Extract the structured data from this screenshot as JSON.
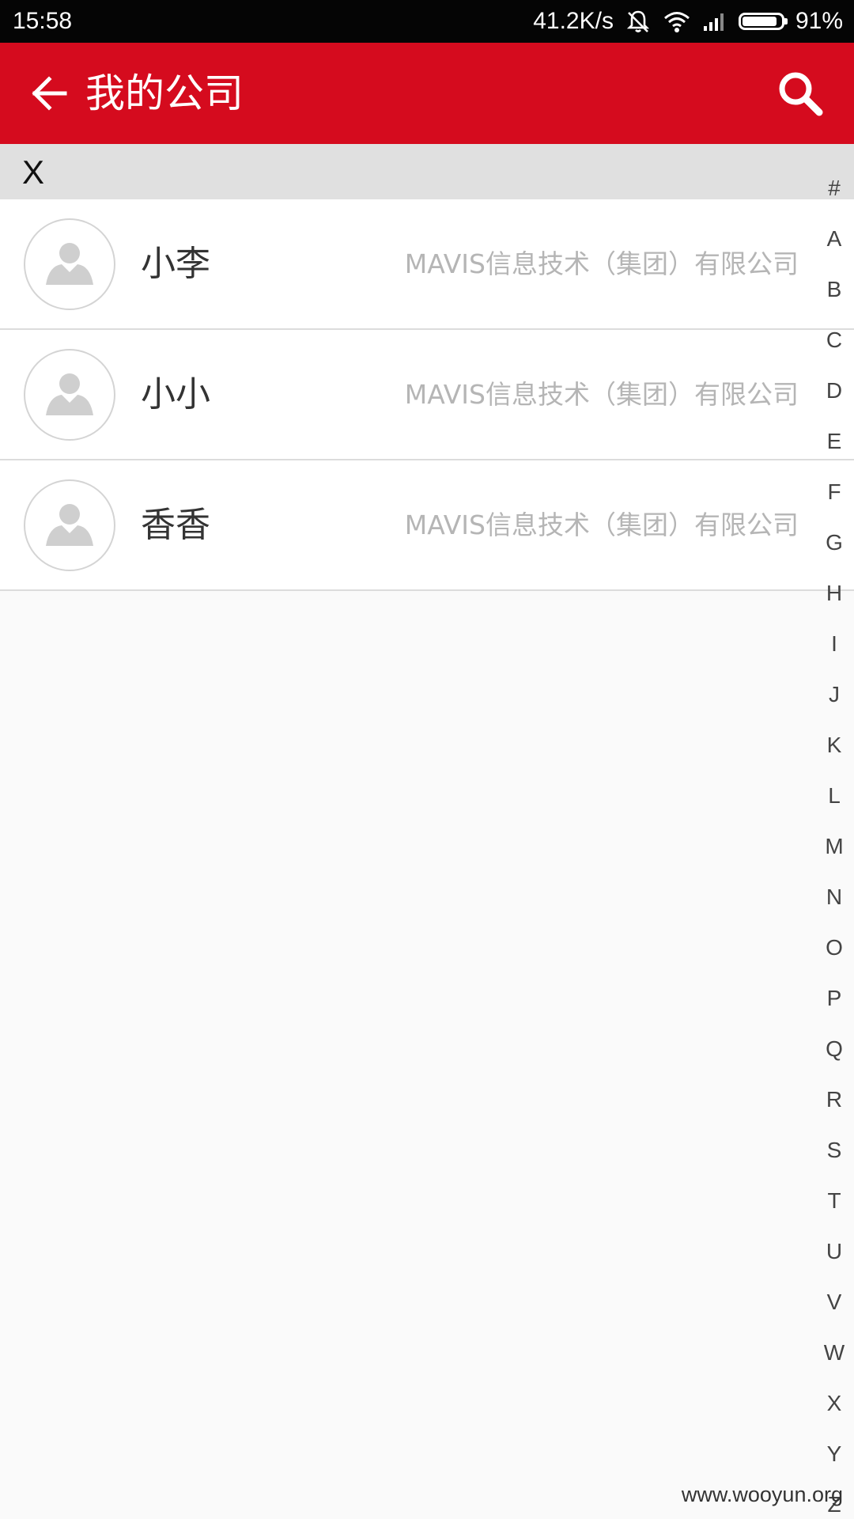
{
  "status_bar": {
    "time": "15:58",
    "network_speed": "41.2K/s",
    "battery_percent": "91%",
    "battery_level": 0.91,
    "icons": [
      "mute-icon",
      "wifi-icon",
      "signal-icon",
      "battery-icon"
    ]
  },
  "toolbar": {
    "back_icon": "arrow-left-icon",
    "title": "我的公司",
    "search_icon": "search-icon",
    "background_color": "#d50b1e"
  },
  "section": {
    "letter": "X"
  },
  "contacts": [
    {
      "name": "小李",
      "company": "MAVIS信息技术（集团）有限公司",
      "avatar_icon": "person-placeholder-icon"
    },
    {
      "name": "小小",
      "company": "MAVIS信息技术（集团）有限公司",
      "avatar_icon": "person-placeholder-icon"
    },
    {
      "name": "香香",
      "company": "MAVIS信息技术（集团）有限公司",
      "avatar_icon": "person-placeholder-icon"
    }
  ],
  "alphabet_index": [
    "#",
    "A",
    "B",
    "C",
    "D",
    "E",
    "F",
    "G",
    "H",
    "I",
    "J",
    "K",
    "L",
    "M",
    "N",
    "O",
    "P",
    "Q",
    "R",
    "S",
    "T",
    "U",
    "V",
    "W",
    "X",
    "Y",
    "Z"
  ],
  "watermark": "www.wooyun.org"
}
